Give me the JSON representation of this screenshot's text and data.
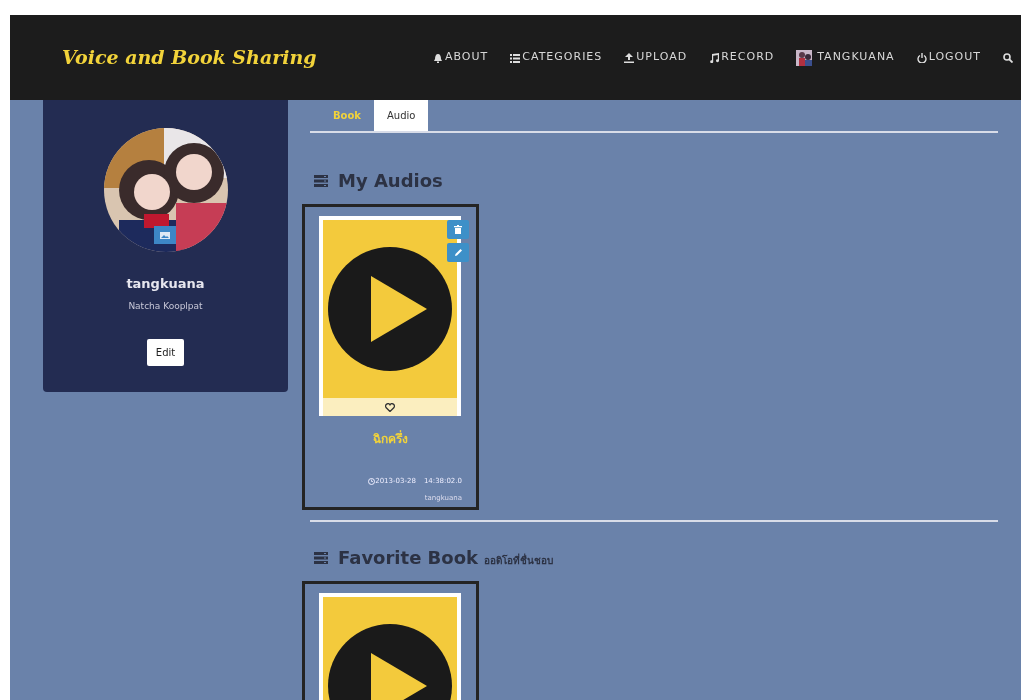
{
  "navbar": {
    "brand": "Voice and Book Sharing",
    "items": [
      {
        "label": "ABOUT",
        "kind": "bell"
      },
      {
        "label": "CATEGORIES",
        "kind": "list"
      },
      {
        "label": "UPLOAD",
        "kind": "upload"
      },
      {
        "label": "RECORD",
        "kind": "music"
      },
      {
        "label": "TANGKUANA",
        "kind": "avatar"
      },
      {
        "label": "LOGOUT",
        "kind": "power"
      },
      {
        "kind": "search"
      }
    ]
  },
  "profile": {
    "username": "tangkuana",
    "full_name": "Natcha Kooplpat",
    "edit_button": "Edit"
  },
  "tabs": [
    {
      "label": "Book",
      "selected": false
    },
    {
      "label": "Audio",
      "selected": true
    }
  ],
  "sections": [
    {
      "title": "My Audios",
      "cards": [
        {
          "title": "ฉิกครึ่ง",
          "date": "2013-03-28",
          "time": "14:38:02.0",
          "user": "tangkuana",
          "kind": "owned"
        }
      ]
    },
    {
      "title": "Favorite Book",
      "subtitle": "ออดิโอที่ชื่นชอบ",
      "cards": [
        {
          "kind": "favorite"
        }
      ]
    }
  ]
}
